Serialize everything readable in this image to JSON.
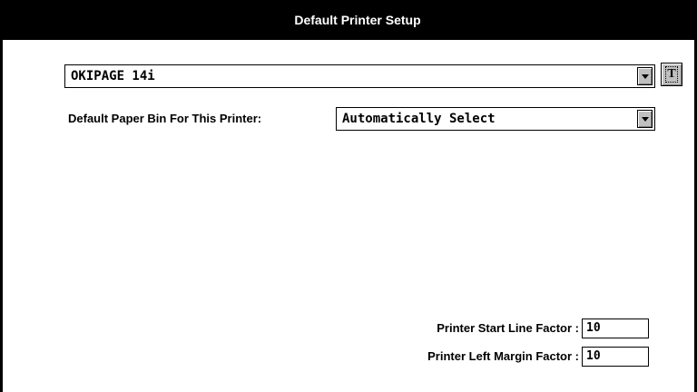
{
  "window": {
    "title": "Default Printer Setup"
  },
  "printer_select": {
    "value": "OKIPAGE 14i"
  },
  "t_button": {
    "label": "T"
  },
  "paper_bin": {
    "label": "Default Paper Bin For This Printer:",
    "value": "Automatically Select"
  },
  "start_line": {
    "label": "Printer Start Line Factor :",
    "value": "10"
  },
  "left_margin": {
    "label": "Printer Left Margin Factor :",
    "value": "10"
  }
}
